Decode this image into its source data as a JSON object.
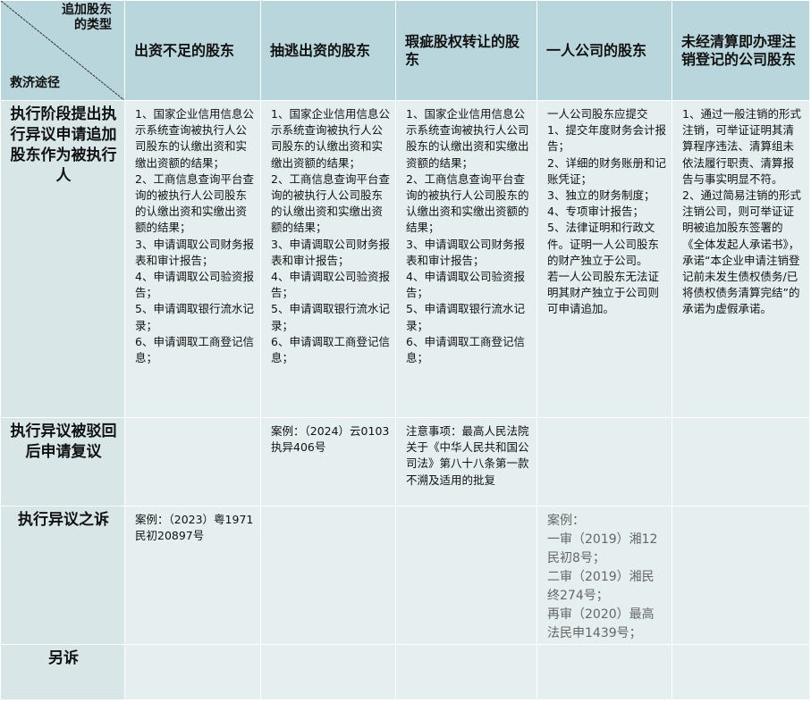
{
  "corner": {
    "top_label_line1": "追加股东",
    "top_label_line2": "的类型",
    "bottom_label": "救济途径"
  },
  "columns": [
    "出资不足的股东",
    "抽逃出资的股东",
    "瑕疵股权转让的股东",
    "一人公司的股东",
    "未经清算即办理注销登记的公司股东"
  ],
  "rows": [
    {
      "label": "执行阶段提出执行异议申请追加股东作为被执行人",
      "cells": [
        [
          "1、国家企业信用信息公示系统查询被执行人公司股东的认缴出资和实缴出资额的结果；",
          "2、工商信息查询平台查询的被执行人公司股东的认缴出资和实缴出资额的结果；",
          "3、申请调取公司财务报表和审计报告；",
          "4、申请调取公司验资报告；",
          "5、申请调取银行流水记录；",
          "6、申请调取工商登记信息；"
        ],
        [
          "1、国家企业信用信息公示系统查询被执行人公司股东的认缴出资和实缴出资额的结果；",
          "2、工商信息查询平台查询的被执行人公司股东的认缴出资和实缴出资额的结果；",
          "3、申请调取公司财务报表和审计报告；",
          "4、申请调取公司验资报告；",
          "5、申请调取银行流水记录；",
          "6、申请调取工商登记信息；"
        ],
        [
          "1、国家企业信用信息公示系统查询被执行人公司股东的认缴出资和实缴出资额的结果；",
          "2、工商信息查询平台查询的被执行人公司股东的认缴出资和实缴出资额的结果；",
          "3、申请调取公司财务报表和审计报告；",
          "4、申请调取公司验资报告；",
          "5、申请调取银行流水记录；",
          "6、申请调取工商登记信息；"
        ],
        [
          "一人公司股东应提交",
          "1、提交年度财务会计报告；",
          "2、详细的财务账册和记账凭证；",
          "3、独立的财务制度；",
          "4、专项审计报告；",
          "5、法律证明和行政文件。证明一人公司股东的财产独立于公司。",
          "若一人公司股东无法证明其财产独立于公司则可申请追加。"
        ],
        [
          "1、通过一般注销的形式注销，可举证证明其清算程序违法、清算组未依法履行职责、清算报告与事实明显不符。",
          "2、通过简易注销的形式注销公司，则可举证证明被追加股东签署的《全体发起人承诺书》，承诺“本企业申请注销登记前未发生债权债务/已将债权债务清算完结”的承诺为虚假承诺。"
        ]
      ]
    },
    {
      "label": "执行异议被驳回后申请复议",
      "cells": [
        [],
        [
          "案例：（2024）云0103执异406号"
        ],
        [
          "注意事项：最高人民法院关于《中华人民共和国公司法》第八十八条第一款不溯及适用的批复"
        ],
        [],
        []
      ]
    },
    {
      "label": "执行异议之诉",
      "cells": [
        [
          "案例：（2023）粤1971民初20897号"
        ],
        [],
        [],
        [
          "案例：",
          "一审（2019）湘12民初8号；",
          "二审（2019）湘民终274号；",
          "再审（2020）最高法民申1439号；"
        ],
        []
      ]
    },
    {
      "label": "另诉",
      "cells": [
        [],
        [],
        [],
        [],
        []
      ]
    }
  ],
  "colors": {
    "header_bg": "#bad6dd",
    "rowhead_bg": "#d8e6e8",
    "cell_bg": "#e5eff0",
    "grid": "#ffffff",
    "case_text": "#666666"
  }
}
